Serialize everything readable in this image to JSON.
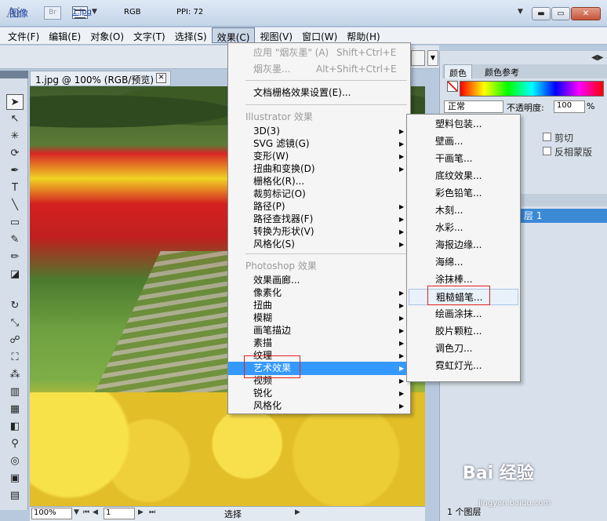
{
  "titlebar": {
    "app_logo": "Ai",
    "bridge": "Br",
    "win_min": "▬",
    "win_max": "▭",
    "win_close": "✕"
  },
  "menubar": {
    "items": [
      "文件(F)",
      "编辑(E)",
      "对象(O)",
      "文字(T)",
      "选择(S)",
      "效果(C)",
      "视图(V)",
      "窗口(W)",
      "帮助(H)"
    ]
  },
  "controlbar": {
    "image_label": "图像",
    "file_name": "1.jpg",
    "color_mode": "RGB",
    "ppi": "PPI: 72"
  },
  "document": {
    "tab_title": "1.jpg @ 100% (RGB/预览)",
    "zoom": "100%",
    "page": "1",
    "status": "选择"
  },
  "effects_menu": {
    "apply_last": "应用 \"烟灰墨\" (A)",
    "apply_last_shortcut": "Shift+Ctrl+E",
    "last_effect": "烟灰墨...",
    "last_effect_shortcut": "Alt+Shift+Ctrl+E",
    "raster_settings": "文档栅格效果设置(E)...",
    "illustrator_section": "Illustrator 效果",
    "illustrator_items": [
      "3D(3)",
      "SVG 滤镜(G)",
      "变形(W)",
      "扭曲和变换(D)",
      "栅格化(R)...",
      "裁剪标记(O)",
      "路径(P)",
      "路径查找器(F)",
      "转换为形状(V)",
      "风格化(S)"
    ],
    "photoshop_section": "Photoshop 效果",
    "photoshop_items": [
      "效果画廊...",
      "像素化",
      "扭曲",
      "模糊",
      "画笔描边",
      "素描",
      "纹理",
      "艺术效果",
      "视频",
      "锐化",
      "风格化"
    ]
  },
  "art_submenu": {
    "items": [
      "塑料包装...",
      "壁画...",
      "干画笔...",
      "底纹效果...",
      "彩色铅笔...",
      "木刻...",
      "水彩...",
      "海报边缘...",
      "海绵...",
      "涂抹棒...",
      "粗糙蜡笔...",
      "绘画涂抹...",
      "胶片颗粒...",
      "调色刀...",
      "霓虹灯光..."
    ]
  },
  "panels": {
    "color_tab": "颜色",
    "color_guide_tab": "颜色参考",
    "blend_mode": "正常",
    "opacity_label": "不透明度:",
    "opacity_value": "100",
    "opacity_unit": "%",
    "clip_label": "剪切",
    "invert_mask_label": "反相蒙版",
    "layer_name": "层 1",
    "layer_count": "1 个图层"
  },
  "watermark": {
    "brand": "Bai 经验",
    "url": "jingyan.baidu.com"
  },
  "colors": {
    "menu_highlight": "#3399ff",
    "annotation_red": "#e02020",
    "layer_selected": "#3c89d6"
  }
}
